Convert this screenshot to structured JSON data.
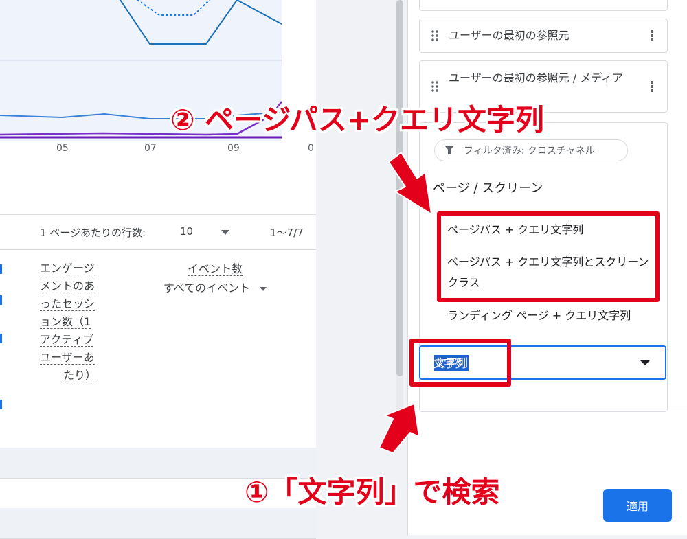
{
  "chart": {
    "ticks": [
      "05",
      "07",
      "09",
      "0"
    ]
  },
  "pager": {
    "rows_label": "1 ページあたりの行数:",
    "rows_value": "10",
    "range": "1〜7/7"
  },
  "table": {
    "engagement_header": [
      "エンゲージ",
      "メントのあ",
      "ったセッシ",
      "ョン数（1",
      "アクティブ",
      "ユーザーあ",
      "たり）"
    ],
    "event_header": "イベント数",
    "event_selector": "すべてのイベント"
  },
  "panel": {
    "cards": [
      {
        "label": "ユーザーの最初の参照元"
      },
      {
        "label": "ユーザーの最初の参照元 / メディア"
      }
    ],
    "filter_chip": "フィルタ済み: クロスチャネル",
    "group_title": "ページ / スクリーン",
    "options": [
      "ページパス + クエリ文字列",
      "ページパス + クエリ文字列とスクリーン クラス",
      "ランディング ページ + クエリ文字列"
    ],
    "search_value": "文字列",
    "apply_label": "適用"
  },
  "annotations": {
    "step2": "② ページパス+クエリ文字列",
    "step1": "①「文字列」で検索",
    "color": "#e3001b"
  },
  "colors": {
    "accent": "#1a73e8",
    "chart_bg": "#eef3fc"
  }
}
